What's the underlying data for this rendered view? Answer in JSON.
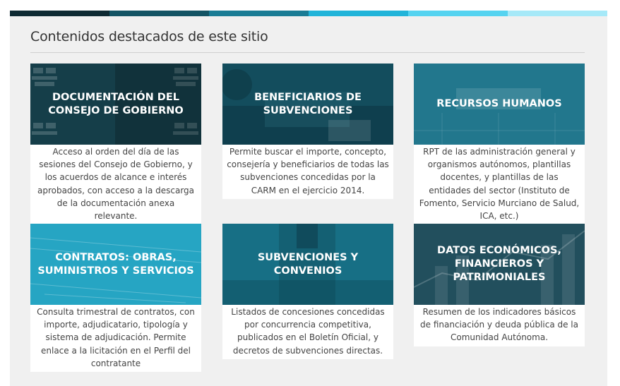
{
  "section": {
    "title": "Contenidos destacados de este sitio"
  },
  "topbar_colors": [
    "#0e2a33",
    "#135464",
    "#1a7c95",
    "#21b4d9",
    "#55d3f0",
    "#a6e9f8"
  ],
  "cards": [
    {
      "title": "DOCUMENTACIÓN DEL CONSEJO DE GOBIERNO",
      "description": "Acceso al orden del día de las sesiones del Consejo de Gobierno, y los acuerdos de alcance e interés aprobados, con acceso a la descarga de la documentación anexa relevante.",
      "bg": "#153e49",
      "icon": "emblem-pattern"
    },
    {
      "title": "BENEFICIARIOS DE SUBVENCIONES",
      "description": "Permite buscar el importe, concepto, consejería y beneficiarios de todas las subvenciones concedidas por la CARM en el ejercicio 2014.",
      "bg": "#134d5d",
      "icon": "business-meeting"
    },
    {
      "title": "RECURSOS HUMANOS",
      "description": "RPT de las administración general y organismos autónomos, plantillas docentes, y plantillas de las entidades del sector (Instituto de Fomento, Servicio Murciano de Salud, ICA, etc.)",
      "bg": "#1d6e83",
      "icon": "handshake"
    },
    {
      "title": "CONTRATOS: OBRAS, SUMINISTROS Y SERVICIOS",
      "description": "Consulta trimestral de contratos, con importe, adjudicatario, tipología y sistema de adjudicación. Permite enlace a la licitación en el Perfil del contratante",
      "bg": "#1c9fbd",
      "icon": "documents"
    },
    {
      "title": "SUBVENCIONES Y CONVENIOS",
      "description": "Listados de concesiones concedidas por concurrencia competitiva, publicados en el Boletín Oficial, y decretos de subvenciones directas.",
      "bg": "#176f85",
      "icon": "business-person"
    },
    {
      "title": "DATOS ECONÓMICOS, FINANCIEROS Y PATRIMONIALES",
      "description": "Resumen de los indicadores básicos de financiación y deuda pública de la Comunidad Autónoma.",
      "bg": "#224f5d",
      "icon": "finance-chart"
    }
  ]
}
